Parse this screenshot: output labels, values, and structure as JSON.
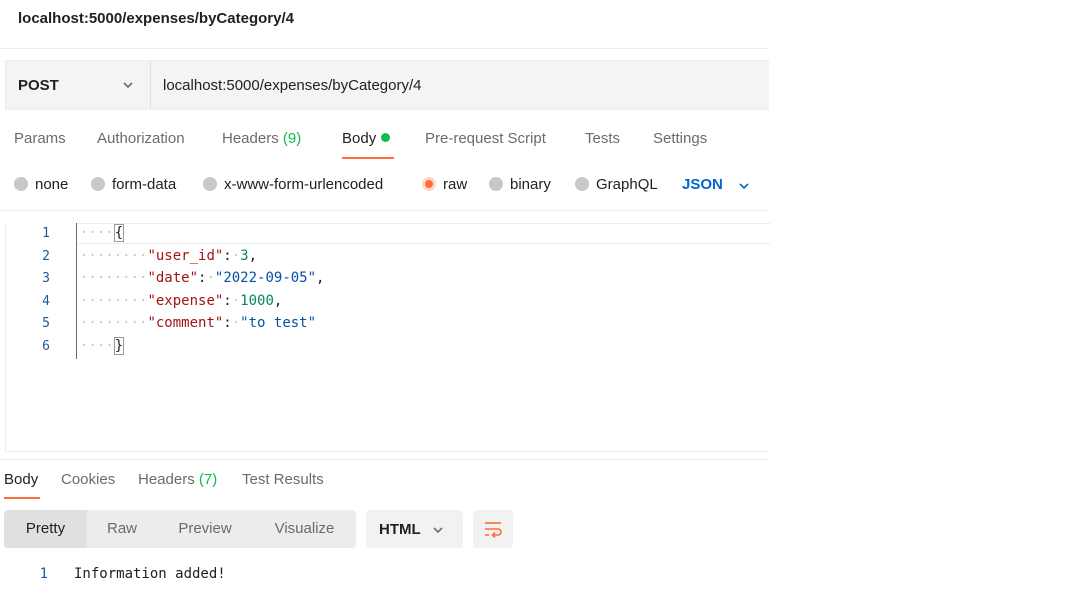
{
  "window": {
    "title": "localhost:5000/expenses/byCategory/4"
  },
  "request": {
    "method": "POST",
    "url": "localhost:5000/expenses/byCategory/4"
  },
  "request_tabs": [
    {
      "label": "Params"
    },
    {
      "label": "Authorization"
    },
    {
      "label": "Headers",
      "count": "(9)"
    },
    {
      "label": "Body",
      "active": true
    },
    {
      "label": "Pre-request Script"
    },
    {
      "label": "Tests"
    },
    {
      "label": "Settings"
    }
  ],
  "body_types": [
    {
      "label": "none"
    },
    {
      "label": "form-data"
    },
    {
      "label": "x-www-form-urlencoded"
    },
    {
      "label": "raw",
      "selected": true
    },
    {
      "label": "binary"
    },
    {
      "label": "GraphQL"
    }
  ],
  "body_format": "JSON",
  "editor": {
    "line_numbers": [
      "1",
      "2",
      "3",
      "4",
      "5",
      "6"
    ],
    "lines": {
      "l1": {
        "brace": "{"
      },
      "l2": {
        "key": "\"user_id\"",
        "colon": ":",
        "value": "3",
        "comma": ","
      },
      "l3": {
        "key": "\"date\"",
        "colon": ":",
        "value": "\"2022-09-05\"",
        "comma": ","
      },
      "l4": {
        "key": "\"expense\"",
        "colon": ":",
        "value": "1000",
        "comma": ","
      },
      "l5": {
        "key": "\"comment\"",
        "colon": ":",
        "value": "\"to test\""
      },
      "l6": {
        "brace": "}"
      }
    }
  },
  "response_tabs": [
    {
      "label": "Body",
      "active": true
    },
    {
      "label": "Cookies"
    },
    {
      "label": "Headers",
      "count": "(7)"
    },
    {
      "label": "Test Results"
    }
  ],
  "view_modes": [
    {
      "label": "Pretty",
      "selected": true
    },
    {
      "label": "Raw"
    },
    {
      "label": "Preview"
    },
    {
      "label": "Visualize"
    }
  ],
  "response_format": "HTML",
  "response_output": {
    "line_number": "1",
    "text": "Information added!"
  },
  "icons": {
    "method_chevron": "chevron-down-icon",
    "format_chevron": "chevron-down-icon",
    "wrap": "wrap-lines-icon"
  },
  "colors": {
    "accent": "#ff6c37",
    "count_green": "#0cbb52",
    "link_blue": "#0265d2"
  }
}
